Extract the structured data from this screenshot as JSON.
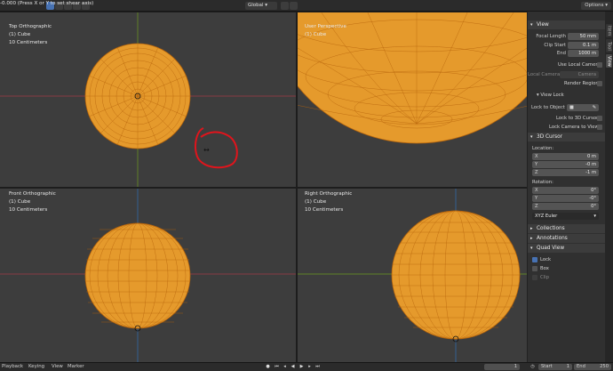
{
  "header": {
    "status_text": "-0.000  (Press X or Y to set shear axis)",
    "orientation": "Global",
    "options": "Options"
  },
  "viewports": {
    "top_left": {
      "view": "Top Orthographic",
      "object": "(1) Cube",
      "scale": "10 Centimeters"
    },
    "top_right": {
      "view": "User Perspective",
      "object": "(1) Cube"
    },
    "bottom_left": {
      "view": "Front Orthographic",
      "object": "(1) Cube",
      "scale": "10 Centimeters"
    },
    "bottom_right": {
      "view": "Right Orthographic",
      "object": "(1) Cube",
      "scale": "10 Centimeters"
    }
  },
  "colors": {
    "mesh_fill": "#e59a2c",
    "mesh_wire": "#b8650b",
    "annotation": "#e0141c",
    "x_axis": "#a13b45",
    "y_axis": "#6d9a1f",
    "z_axis": "#2f6db5",
    "accent": "#4772b3"
  },
  "sidebar": {
    "tabs": [
      "Item",
      "Tool",
      "View"
    ],
    "view_panel": {
      "title": "View",
      "focal_length_label": "Focal Length",
      "focal_length": "50 mm",
      "clip_start_label": "Clip Start",
      "clip_start": "0.1 m",
      "end_label": "End",
      "end": "1000 m",
      "use_local_camera": "Use Local Camera",
      "local_camera_label": "Local Camera",
      "local_camera": "Camera",
      "render_region": "Render Region"
    },
    "view_lock": {
      "title": "View Lock",
      "lock_to_object": "Lock to Object",
      "lock_to_3d_cursor": "Lock to 3D Cursor",
      "lock_camera_to_view": "Lock Camera to View"
    },
    "cursor_panel": {
      "title": "3D Cursor",
      "location_label": "Location:",
      "location": [
        {
          "axis": "X",
          "value": "0 m"
        },
        {
          "axis": "Y",
          "value": "-0 m"
        },
        {
          "axis": "Z",
          "value": "-1 m"
        }
      ],
      "rotation_label": "Rotation:",
      "rotation": [
        {
          "axis": "X",
          "value": "0°"
        },
        {
          "axis": "Y",
          "value": "-0°"
        },
        {
          "axis": "Z",
          "value": "0°"
        }
      ],
      "rotation_mode": "XYZ Euler"
    },
    "collections": "Collections",
    "annotations": "Annotations",
    "quad_view": {
      "title": "Quad View",
      "lock": "Lock",
      "box": "Box",
      "clip": "Clip"
    }
  },
  "timeline": {
    "playback": "Playback",
    "keying": "Keying",
    "view": "View",
    "marker": "Marker",
    "current_frame": "1",
    "start_label": "Start",
    "start": "1",
    "end_label": "End",
    "end": "250"
  }
}
